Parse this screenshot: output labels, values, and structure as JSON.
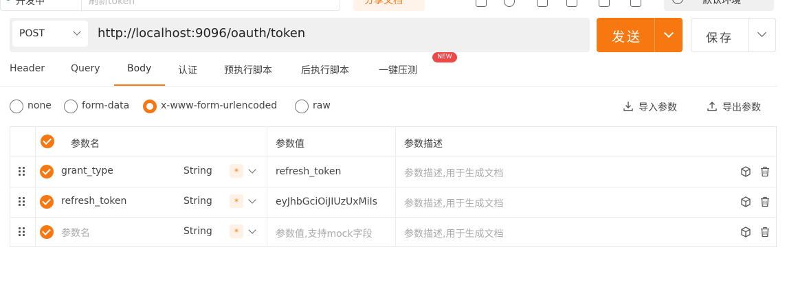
{
  "topbar": {
    "env_name": "开发中",
    "search_placeholder": "刷新token",
    "share_label": "分享文档",
    "env_select": "默认环境"
  },
  "request": {
    "method": "POST",
    "url": "http://localhost:9096/oauth/token",
    "send_label": "发送",
    "save_label": "保存"
  },
  "tabs": [
    {
      "label": "Header"
    },
    {
      "label": "Query"
    },
    {
      "label": "Body"
    },
    {
      "label": "认证"
    },
    {
      "label": "预执行脚本"
    },
    {
      "label": "后执行脚本"
    },
    {
      "label": "一键压测"
    }
  ],
  "active_tab": "Body",
  "new_badge": "NEW",
  "body_types": [
    {
      "label": "none",
      "selected": false
    },
    {
      "label": "form-data",
      "selected": false
    },
    {
      "label": "x-www-form-urlencoded",
      "selected": true
    },
    {
      "label": "raw",
      "selected": false
    }
  ],
  "import_label": "导入参数",
  "export_label": "导出参数",
  "table": {
    "headers": {
      "name": "参数名",
      "value": "参数值",
      "desc": "参数描述"
    },
    "rows": [
      {
        "name": "grant_type",
        "name_is_placeholder": false,
        "type": "String",
        "required": "*",
        "value": "refresh_token",
        "value_is_placeholder": false,
        "desc": "参数描述,用于生成文档"
      },
      {
        "name": "refresh_token",
        "name_is_placeholder": false,
        "type": "String",
        "required": "*",
        "value": "eyJhbGciOiJIUzUxMiIs",
        "value_is_placeholder": false,
        "desc": "参数描述,用于生成文档"
      },
      {
        "name": "参数名",
        "name_is_placeholder": true,
        "type": "String",
        "required": "*",
        "value": "参数值,支持mock字段",
        "value_is_placeholder": true,
        "desc": "参数描述,用于生成文档"
      }
    ]
  },
  "colors": {
    "accent": "#f77810",
    "badge": "#f04848"
  }
}
